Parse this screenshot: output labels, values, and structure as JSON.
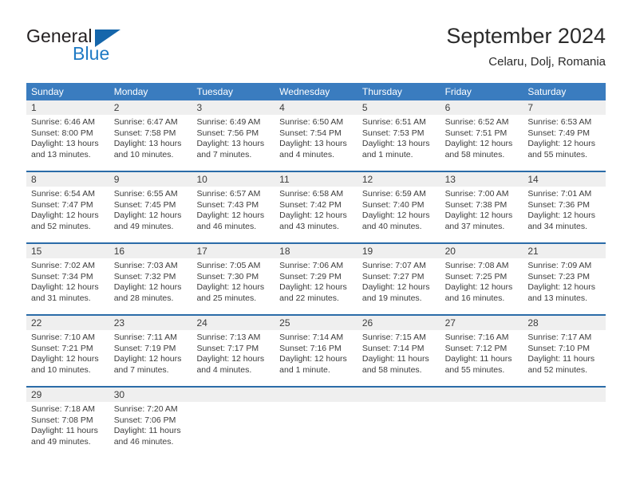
{
  "brand": {
    "name_part1": "General",
    "name_part2": "Blue",
    "flag_icon": "triangle-flag-icon",
    "accent_color": "#1566ab"
  },
  "header": {
    "month_title": "September 2024",
    "location": "Celaru, Dolj, Romania"
  },
  "calendar": {
    "header_bg": "#3a7cbf",
    "row_separator_color": "#2b6ca8",
    "date_band_bg": "#efefef",
    "day_names": [
      "Sunday",
      "Monday",
      "Tuesday",
      "Wednesday",
      "Thursday",
      "Friday",
      "Saturday"
    ],
    "weeks": [
      {
        "days": [
          {
            "date": "1",
            "sunrise": "Sunrise: 6:46 AM",
            "sunset": "Sunset: 8:00 PM",
            "daylight_line1": "Daylight: 13 hours",
            "daylight_line2": "and 13 minutes."
          },
          {
            "date": "2",
            "sunrise": "Sunrise: 6:47 AM",
            "sunset": "Sunset: 7:58 PM",
            "daylight_line1": "Daylight: 13 hours",
            "daylight_line2": "and 10 minutes."
          },
          {
            "date": "3",
            "sunrise": "Sunrise: 6:49 AM",
            "sunset": "Sunset: 7:56 PM",
            "daylight_line1": "Daylight: 13 hours",
            "daylight_line2": "and 7 minutes."
          },
          {
            "date": "4",
            "sunrise": "Sunrise: 6:50 AM",
            "sunset": "Sunset: 7:54 PM",
            "daylight_line1": "Daylight: 13 hours",
            "daylight_line2": "and 4 minutes."
          },
          {
            "date": "5",
            "sunrise": "Sunrise: 6:51 AM",
            "sunset": "Sunset: 7:53 PM",
            "daylight_line1": "Daylight: 13 hours",
            "daylight_line2": "and 1 minute."
          },
          {
            "date": "6",
            "sunrise": "Sunrise: 6:52 AM",
            "sunset": "Sunset: 7:51 PM",
            "daylight_line1": "Daylight: 12 hours",
            "daylight_line2": "and 58 minutes."
          },
          {
            "date": "7",
            "sunrise": "Sunrise: 6:53 AM",
            "sunset": "Sunset: 7:49 PM",
            "daylight_line1": "Daylight: 12 hours",
            "daylight_line2": "and 55 minutes."
          }
        ]
      },
      {
        "days": [
          {
            "date": "8",
            "sunrise": "Sunrise: 6:54 AM",
            "sunset": "Sunset: 7:47 PM",
            "daylight_line1": "Daylight: 12 hours",
            "daylight_line2": "and 52 minutes."
          },
          {
            "date": "9",
            "sunrise": "Sunrise: 6:55 AM",
            "sunset": "Sunset: 7:45 PM",
            "daylight_line1": "Daylight: 12 hours",
            "daylight_line2": "and 49 minutes."
          },
          {
            "date": "10",
            "sunrise": "Sunrise: 6:57 AM",
            "sunset": "Sunset: 7:43 PM",
            "daylight_line1": "Daylight: 12 hours",
            "daylight_line2": "and 46 minutes."
          },
          {
            "date": "11",
            "sunrise": "Sunrise: 6:58 AM",
            "sunset": "Sunset: 7:42 PM",
            "daylight_line1": "Daylight: 12 hours",
            "daylight_line2": "and 43 minutes."
          },
          {
            "date": "12",
            "sunrise": "Sunrise: 6:59 AM",
            "sunset": "Sunset: 7:40 PM",
            "daylight_line1": "Daylight: 12 hours",
            "daylight_line2": "and 40 minutes."
          },
          {
            "date": "13",
            "sunrise": "Sunrise: 7:00 AM",
            "sunset": "Sunset: 7:38 PM",
            "daylight_line1": "Daylight: 12 hours",
            "daylight_line2": "and 37 minutes."
          },
          {
            "date": "14",
            "sunrise": "Sunrise: 7:01 AM",
            "sunset": "Sunset: 7:36 PM",
            "daylight_line1": "Daylight: 12 hours",
            "daylight_line2": "and 34 minutes."
          }
        ]
      },
      {
        "days": [
          {
            "date": "15",
            "sunrise": "Sunrise: 7:02 AM",
            "sunset": "Sunset: 7:34 PM",
            "daylight_line1": "Daylight: 12 hours",
            "daylight_line2": "and 31 minutes."
          },
          {
            "date": "16",
            "sunrise": "Sunrise: 7:03 AM",
            "sunset": "Sunset: 7:32 PM",
            "daylight_line1": "Daylight: 12 hours",
            "daylight_line2": "and 28 minutes."
          },
          {
            "date": "17",
            "sunrise": "Sunrise: 7:05 AM",
            "sunset": "Sunset: 7:30 PM",
            "daylight_line1": "Daylight: 12 hours",
            "daylight_line2": "and 25 minutes."
          },
          {
            "date": "18",
            "sunrise": "Sunrise: 7:06 AM",
            "sunset": "Sunset: 7:29 PM",
            "daylight_line1": "Daylight: 12 hours",
            "daylight_line2": "and 22 minutes."
          },
          {
            "date": "19",
            "sunrise": "Sunrise: 7:07 AM",
            "sunset": "Sunset: 7:27 PM",
            "daylight_line1": "Daylight: 12 hours",
            "daylight_line2": "and 19 minutes."
          },
          {
            "date": "20",
            "sunrise": "Sunrise: 7:08 AM",
            "sunset": "Sunset: 7:25 PM",
            "daylight_line1": "Daylight: 12 hours",
            "daylight_line2": "and 16 minutes."
          },
          {
            "date": "21",
            "sunrise": "Sunrise: 7:09 AM",
            "sunset": "Sunset: 7:23 PM",
            "daylight_line1": "Daylight: 12 hours",
            "daylight_line2": "and 13 minutes."
          }
        ]
      },
      {
        "days": [
          {
            "date": "22",
            "sunrise": "Sunrise: 7:10 AM",
            "sunset": "Sunset: 7:21 PM",
            "daylight_line1": "Daylight: 12 hours",
            "daylight_line2": "and 10 minutes."
          },
          {
            "date": "23",
            "sunrise": "Sunrise: 7:11 AM",
            "sunset": "Sunset: 7:19 PM",
            "daylight_line1": "Daylight: 12 hours",
            "daylight_line2": "and 7 minutes."
          },
          {
            "date": "24",
            "sunrise": "Sunrise: 7:13 AM",
            "sunset": "Sunset: 7:17 PM",
            "daylight_line1": "Daylight: 12 hours",
            "daylight_line2": "and 4 minutes."
          },
          {
            "date": "25",
            "sunrise": "Sunrise: 7:14 AM",
            "sunset": "Sunset: 7:16 PM",
            "daylight_line1": "Daylight: 12 hours",
            "daylight_line2": "and 1 minute."
          },
          {
            "date": "26",
            "sunrise": "Sunrise: 7:15 AM",
            "sunset": "Sunset: 7:14 PM",
            "daylight_line1": "Daylight: 11 hours",
            "daylight_line2": "and 58 minutes."
          },
          {
            "date": "27",
            "sunrise": "Sunrise: 7:16 AM",
            "sunset": "Sunset: 7:12 PM",
            "daylight_line1": "Daylight: 11 hours",
            "daylight_line2": "and 55 minutes."
          },
          {
            "date": "28",
            "sunrise": "Sunrise: 7:17 AM",
            "sunset": "Sunset: 7:10 PM",
            "daylight_line1": "Daylight: 11 hours",
            "daylight_line2": "and 52 minutes."
          }
        ]
      },
      {
        "days": [
          {
            "date": "29",
            "sunrise": "Sunrise: 7:18 AM",
            "sunset": "Sunset: 7:08 PM",
            "daylight_line1": "Daylight: 11 hours",
            "daylight_line2": "and 49 minutes."
          },
          {
            "date": "30",
            "sunrise": "Sunrise: 7:20 AM",
            "sunset": "Sunset: 7:06 PM",
            "daylight_line1": "Daylight: 11 hours",
            "daylight_line2": "and 46 minutes."
          },
          {
            "date": "",
            "sunrise": "",
            "sunset": "",
            "daylight_line1": "",
            "daylight_line2": ""
          },
          {
            "date": "",
            "sunrise": "",
            "sunset": "",
            "daylight_line1": "",
            "daylight_line2": ""
          },
          {
            "date": "",
            "sunrise": "",
            "sunset": "",
            "daylight_line1": "",
            "daylight_line2": ""
          },
          {
            "date": "",
            "sunrise": "",
            "sunset": "",
            "daylight_line1": "",
            "daylight_line2": ""
          },
          {
            "date": "",
            "sunrise": "",
            "sunset": "",
            "daylight_line1": "",
            "daylight_line2": ""
          }
        ]
      }
    ]
  }
}
